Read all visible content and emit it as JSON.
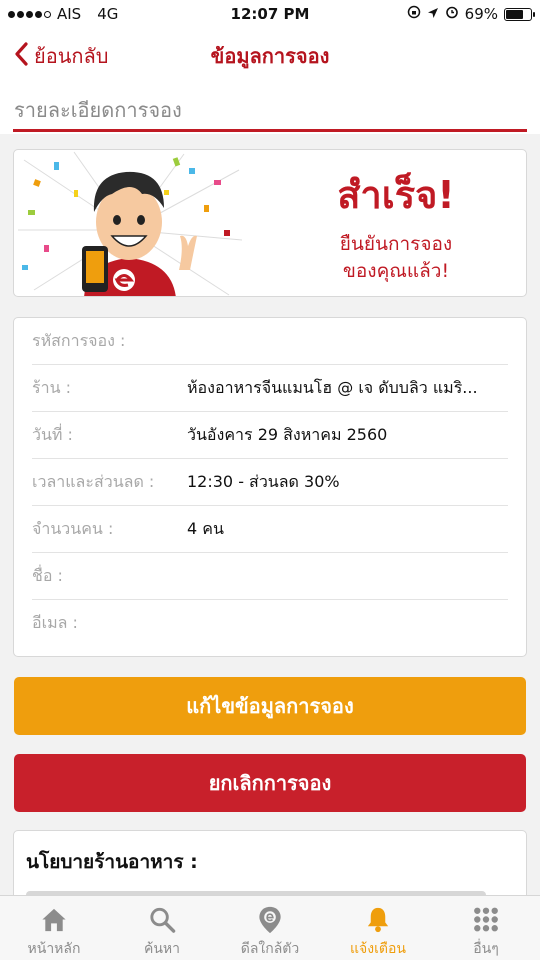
{
  "status_bar": {
    "carrier": "AIS",
    "network": "4G",
    "time": "12:07 PM",
    "battery": "69%",
    "battery_level": 0.69,
    "signal_bars": 4
  },
  "nav": {
    "back_label": "ย้อนกลับ",
    "title": "ข้อมูลการจอง"
  },
  "page_subtitle": "รายละเอียดการจอง",
  "banner": {
    "title": "สำเร็จ!",
    "line1": "ยืนยันการจอง",
    "line2": "ของคุณแล้ว!",
    "accent_color": "#c01a24"
  },
  "details": [
    {
      "label": "รหัสการจอง :",
      "value": ""
    },
    {
      "label": "ร้าน :",
      "value": "ห้องอาหารจีนแมนโฮ @ เจ ดับบลิว แมริ..."
    },
    {
      "label": "วันที่ :",
      "value": "วันอังคาร 29 สิงหาคม 2560"
    },
    {
      "label": "เวลาและส่วนลด :",
      "value": "12:30 - ส่วนลด 30%"
    },
    {
      "label": "จำนวนคน :",
      "value": "4 คน"
    },
    {
      "label": "ชื่อ :",
      "value": ""
    },
    {
      "label": "อีเมล :",
      "value": ""
    }
  ],
  "buttons": {
    "edit_label": "แก้ไขข้อมูลการจอง",
    "cancel_label": "ยกเลิกการจอง",
    "edit_color": "#ef9e0d",
    "cancel_color": "#c8202b"
  },
  "policy": {
    "title": "นโยบายร้านอาหาร :"
  },
  "tabs": [
    {
      "label": "หน้าหลัก",
      "icon": "home-icon",
      "active": false
    },
    {
      "label": "ค้นหา",
      "icon": "search-icon",
      "active": false
    },
    {
      "label": "ดีลใกล้ตัว",
      "icon": "location-pin-icon",
      "active": false
    },
    {
      "label": "แจ้งเตือน",
      "icon": "bell-icon",
      "active": true
    },
    {
      "label": "อื่นๆ",
      "icon": "grid-icon",
      "active": false
    }
  ]
}
